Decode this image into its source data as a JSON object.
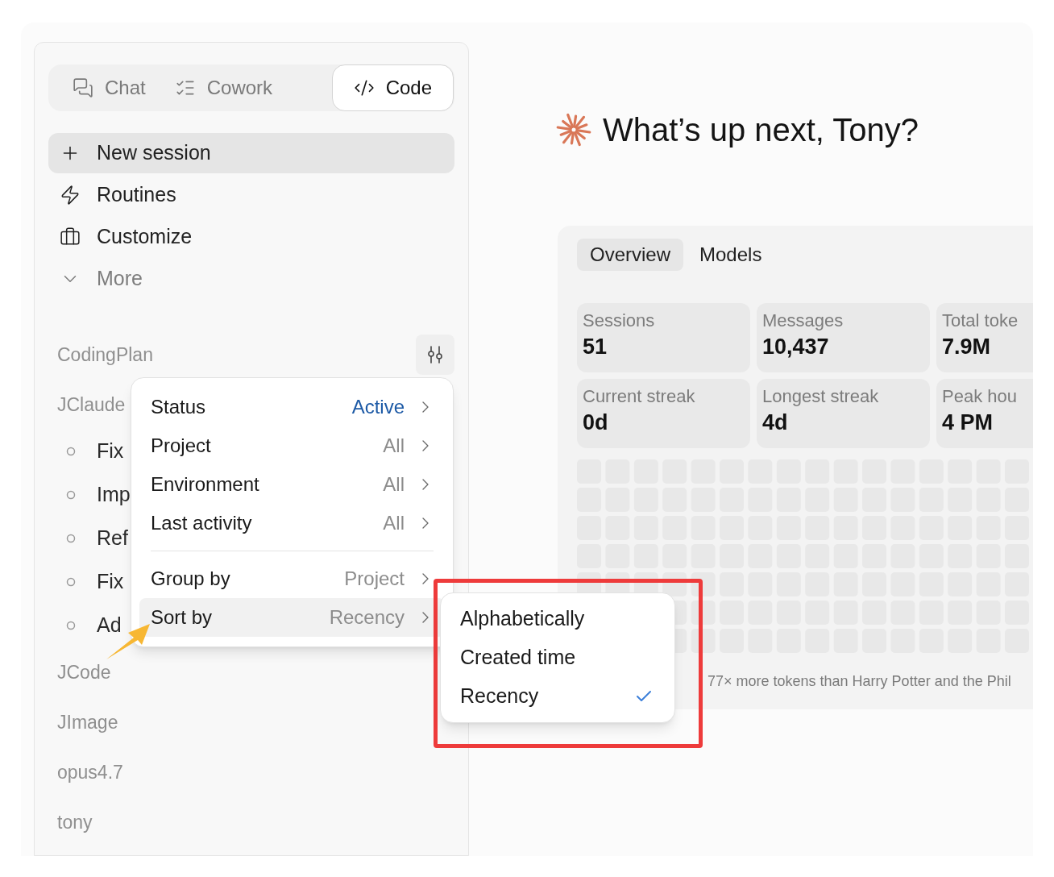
{
  "mode_tabs": [
    {
      "label": "Chat",
      "selected": false
    },
    {
      "label": "Cowork",
      "selected": false
    },
    {
      "label": "Code",
      "selected": true
    }
  ],
  "nav": [
    {
      "label": "New session",
      "kind": "action",
      "selected": true
    },
    {
      "label": "Routines",
      "kind": "action",
      "selected": false
    },
    {
      "label": "Customize",
      "kind": "action",
      "selected": false
    },
    {
      "label": "More",
      "kind": "expander",
      "expanded": false
    }
  ],
  "groups": [
    {
      "label": "CodingPlan"
    },
    {
      "label": "JClaude",
      "sessions": [
        "Fix",
        "Imp",
        "Ref",
        "Fix",
        "Ad"
      ]
    },
    {
      "label": "JCode"
    },
    {
      "label": "JImage"
    },
    {
      "label": "opus4.7"
    },
    {
      "label": "tony"
    }
  ],
  "filter_menu": {
    "filters": [
      {
        "label": "Status",
        "value": "Active",
        "set": true
      },
      {
        "label": "Project",
        "value": "All",
        "set": false
      },
      {
        "label": "Environment",
        "value": "All",
        "set": false
      },
      {
        "label": "Last activity",
        "value": "All",
        "set": false
      }
    ],
    "view_options": [
      {
        "label": "Group by",
        "value": "Project",
        "selected": false
      },
      {
        "label": "Sort by",
        "value": "Recency",
        "selected": true
      }
    ]
  },
  "sort_submenu": [
    {
      "label": "Alphabetically",
      "selected": false
    },
    {
      "label": "Created time",
      "selected": false
    },
    {
      "label": "Recency",
      "selected": true
    }
  ],
  "greeting": "What’s up next, Tony?",
  "stats": {
    "tabs": [
      {
        "label": "Overview",
        "selected": true
      },
      {
        "label": "Models",
        "selected": false
      }
    ],
    "cards": [
      {
        "label": "Sessions",
        "value": "51"
      },
      {
        "label": "Messages",
        "value": "10,437"
      },
      {
        "label": "Total toke",
        "value": "7.9M"
      },
      {
        "label": "Current streak",
        "value": "0d"
      },
      {
        "label": "Longest streak",
        "value": "4d"
      },
      {
        "label": "Peak hou",
        "value": "4 PM"
      }
    ],
    "footnote": "77× more tokens than Harry Potter and the Phil"
  }
}
